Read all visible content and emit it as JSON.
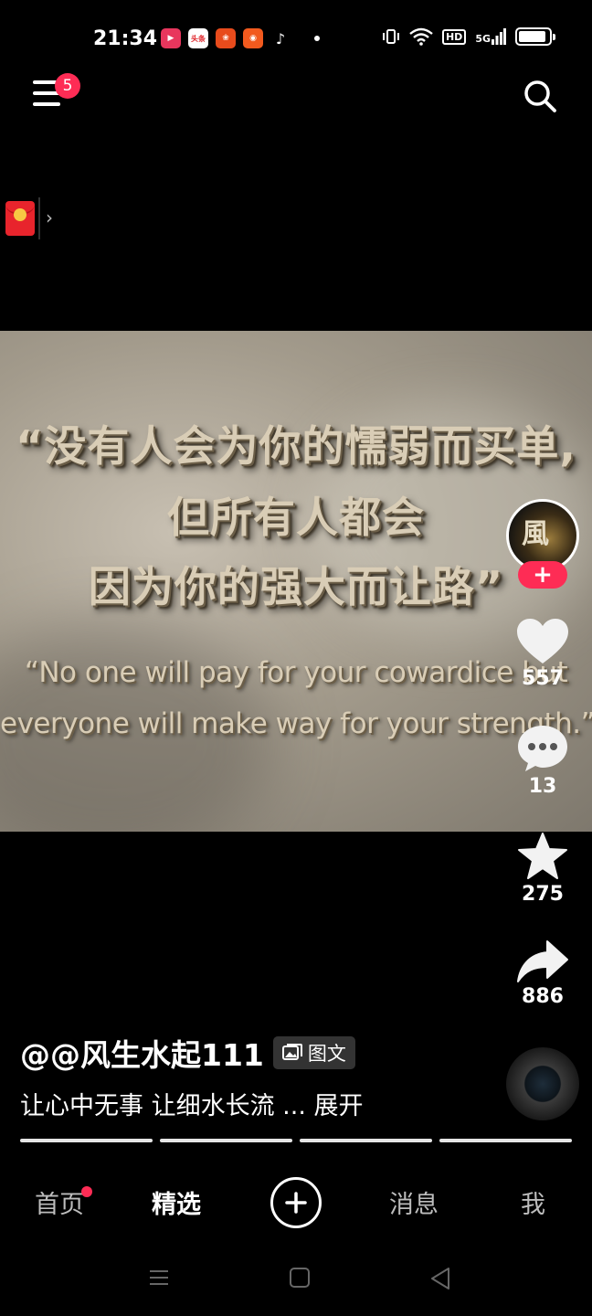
{
  "status_bar": {
    "time": "21:34",
    "notification_icons": [
      "video-app-icon",
      "toutiao-icon",
      "pinduoduo-icon",
      "taobao-icon",
      "tiktok-icon",
      "more-dot-icon"
    ],
    "toutiao_label": "头条",
    "system_icons": [
      "vibrate-icon",
      "wifi-icon",
      "hd-icon",
      "signal-5g-icon",
      "battery-icon"
    ],
    "hd_label": "HD",
    "network_label": "5G",
    "battery_level": 0.9
  },
  "top_bar": {
    "menu_badge": "5"
  },
  "red_packet": {
    "arrow": "›"
  },
  "media": {
    "quote_cn": [
      "“没有人会为你的懦弱而买单,",
      "但所有人都会",
      "因为你的强大而让路”"
    ],
    "quote_en": [
      "“No one will pay for your cowardice but",
      "everyone will make way for your strength.”"
    ]
  },
  "right_rail": {
    "avatar_glyph": "風",
    "follow_label": "+",
    "likes": "557",
    "comments": "13",
    "favorites": "275",
    "shares": "886"
  },
  "caption": {
    "author": "@@风生水起111",
    "tag": "图文",
    "description": "让心中无事 让细水长流 ... ",
    "expand": "展开"
  },
  "progress": {
    "segments": 4
  },
  "bottom_nav": {
    "home": "首页",
    "featured": "精选",
    "create": "+",
    "messages": "消息",
    "me": "我"
  },
  "colors": {
    "accent": "#fe2c55",
    "background": "#000000"
  }
}
